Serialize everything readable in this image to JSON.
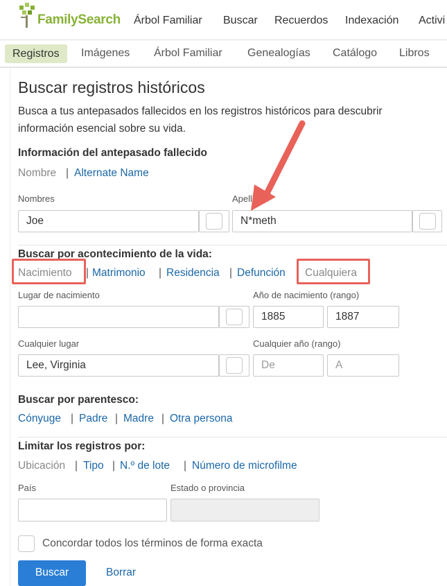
{
  "brand": {
    "name": "FamilySearch",
    "color": "#87b236"
  },
  "topnav": [
    "Árbol Familiar",
    "Buscar",
    "Recuerdos",
    "Indexación",
    "Activi"
  ],
  "subnav": {
    "active": "Registros",
    "items": [
      "Imágenes",
      "Árbol Familiar",
      "Genealogías",
      "Catálogo",
      "Libros"
    ]
  },
  "page": {
    "title": "Buscar registros históricos",
    "intro_line1": "Busca a tus antepasados fallecidos en los registros históricos para descubrir",
    "intro_line2": "información esencial sobre su vida."
  },
  "ancestor": {
    "title": "Información del antepasado fallecido",
    "mode_name": "Nombre",
    "mode_alt": "Alternate Name",
    "given_label": "Nombres",
    "given_value": "Joe",
    "surname_label": "Apellidos",
    "surname_value": "N*meth"
  },
  "life_event": {
    "title": "Buscar por acontecimiento de la vida:",
    "tabs": [
      "Nacimiento",
      "Matrimonio",
      "Residencia",
      "Defunción",
      "Cualquiera"
    ],
    "birthplace_label": "Lugar de nacimiento",
    "birthplace_value": "",
    "birthyear_label": "Año de nacimiento (rango)",
    "birthyear_from": "1885",
    "birthyear_to": "1887",
    "anyplace_label": "Cualquier lugar",
    "anyplace_value": "Lee, Virginia",
    "anyyear_label": "Cualquier año (rango)",
    "anyyear_from_placeholder": "De",
    "anyyear_to_placeholder": "A"
  },
  "relationship": {
    "title": "Buscar por parentesco:",
    "links": [
      "Cónyuge",
      "Padre",
      "Madre",
      "Otra persona"
    ]
  },
  "limit": {
    "title": "Limitar los registros por:",
    "links": [
      "Ubicación",
      "Tipo",
      "N.º de lote",
      "Número de microfilme"
    ],
    "country_label": "País",
    "state_label": "Estado o provincia"
  },
  "exact_label": "Concordar todos los términos de forma exacta",
  "buttons": {
    "search": "Buscar",
    "clear": "Borrar"
  },
  "colors": {
    "link": "#1a67a8",
    "primary": "#2a7ed6",
    "highlight": "#e8625a"
  }
}
